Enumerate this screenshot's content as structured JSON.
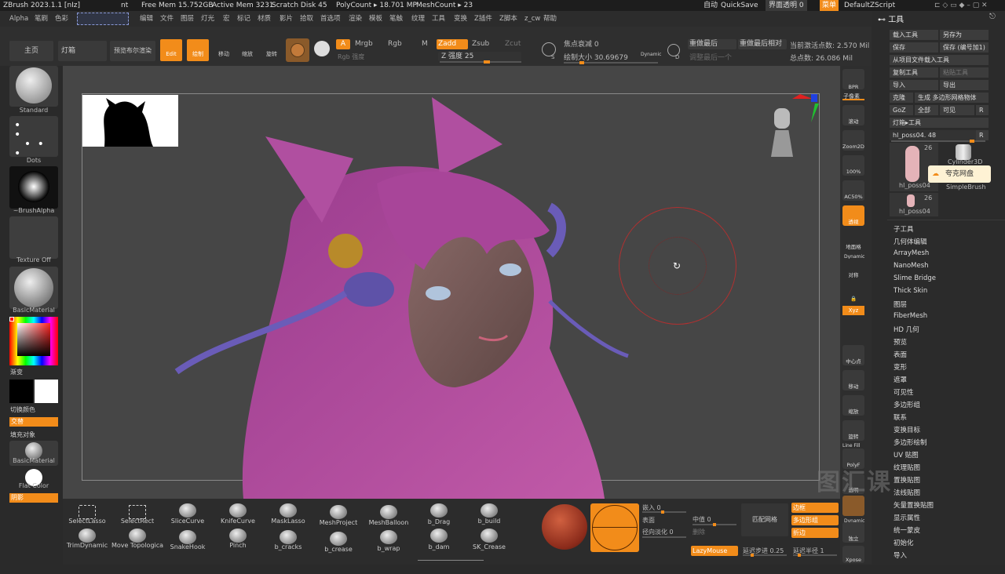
{
  "titlebar": {
    "app": "ZBrush 2023.1.1 [nIz]",
    "frag": "nt",
    "free_mem": "Free Mem 15.752GB",
    "active_mem": "Active Mem 3231",
    "scratch": "Scratch Disk 45",
    "polycount": "PolyCount ▸ 18.701 MP",
    "meshcount": "MeshCount ▸ 23",
    "auto": "自动",
    "quicksave": "QuickSave",
    "transparency": "界面透明 0",
    "menu": "菜单",
    "script": "DefaultZScript"
  },
  "menubar": [
    "Alpha",
    "笔刷",
    "色彩",
    "编辑",
    "文件",
    "图层",
    "灯光",
    "宏",
    "标记",
    "材质",
    "影片",
    "拾取",
    "首选项",
    "渲染",
    "模板",
    "笔触",
    "纹理",
    "工具",
    "变换",
    "Z插件",
    "Z脚本",
    "z_cw",
    "帮助"
  ],
  "topshelf": {
    "home": "主页",
    "lightbox": "灯箱",
    "bpr": "预览布尔渲染",
    "edit": "Edit",
    "draw": "绘制",
    "move": "移动",
    "scale": "缩放",
    "rotate": "旋转",
    "a": "A",
    "mrgb": "Mrgb",
    "rgb": "Rgb",
    "m": "M",
    "zadd": "Zadd",
    "zsub": "Zsub",
    "zcut": "Zcut",
    "rgb_intensity": "Rgb 强度",
    "z_intensity": "Z 强度 25",
    "focal": "焦点衰减 0",
    "draw_size": "绘制大小 30.69679",
    "dynamic": "Dynamic",
    "s": "S",
    "d": "D",
    "redo_last": "重做最后",
    "redo_last_rel": "重做最后相对",
    "adjust_last": "调整最后一个",
    "active_points": "当前激活点数: 2.570 Mil",
    "total_points": "总点数: 26.086 Mil"
  },
  "leftshelf": {
    "standard": "Standard",
    "dots": "Dots",
    "brushalpha": "~BrushAlpha",
    "texture_off": "Texture Off",
    "basic_material": "BasicMaterial",
    "gradient": "渐变",
    "switch_color": "切换颜色",
    "alternate": "交替",
    "fill_object": "填充对象",
    "basic_material2": "BasicMaterial",
    "flat_color": "Flat Color",
    "shadow": "阴影"
  },
  "rightshelf": [
    "BPR",
    "子像素",
    "滚动",
    "Zoom2D",
    "100%",
    "AC50%",
    "透视",
    "地面格",
    "Dynamic",
    "对称",
    "",
    "Xyz",
    "",
    "中心点",
    "移动",
    "缩放",
    "旋转",
    "Line Fill",
    "PolyF",
    "透明",
    "Dynamic",
    "独立",
    "Xpose"
  ],
  "toolpanel": {
    "title": "工具",
    "load_tool": "载入工具",
    "save_as": "另存为",
    "save": "保存",
    "save_inc": "保存 (编号加1)",
    "load_from_project": "从项目文件载入工具",
    "copy_tool": "复制工具",
    "paste_tool": "粘贴工具",
    "import": "导入",
    "export": "导出",
    "clone": "克隆",
    "make_polymesh": "生成 多边形网格物体",
    "goz": "GoZ",
    "all": "全部",
    "visible": "可见",
    "r": "R",
    "lightbox_tools": "灯箱▸工具",
    "current_tool": "hl_poss04. 48",
    "thumb1_count": "26",
    "thumb1_label": "hl_poss04",
    "thumb2_label": "Cylinder3D",
    "thumb3_label": "SimpleBrush",
    "thumb4_count": "26",
    "thumb4_label": "hl_poss04",
    "popup": "夸克网盘",
    "list": [
      "子工具",
      "几何体编辑",
      "ArrayMesh",
      "NanoMesh",
      "Slime Bridge",
      "Thick Skin",
      "图层",
      "FiberMesh",
      "HD 几何",
      "预览",
      "表面",
      "变形",
      "遮罩",
      "可见性",
      "多边形组",
      "联系",
      "变换目标",
      "多边形绘制",
      "UV 贴图",
      "纹理贴图",
      "置换贴图",
      "法线贴图",
      "矢量置换贴图",
      "显示属性",
      "统一蒙皮",
      "初始化",
      "导入"
    ]
  },
  "bottombar": {
    "brushes": [
      "SelectLasso",
      "SelectRect",
      "SliceCurve",
      "KnifeCurve",
      "MaskLasso",
      "MeshProject",
      "MeshBalloon",
      "b_Drag",
      "b_build",
      "TrimDynamic",
      "Move Topologica",
      "SnakeHook",
      "Pinch",
      "b_cracks",
      "b_crease",
      "b_wrap",
      "b_dam",
      "SK_Crease"
    ],
    "embed": "嵌入 0",
    "surface": "表面",
    "radial_fade": "径向淡化 0",
    "median": "中值 0",
    "delete": "删除",
    "match_mesh": "匹配网格",
    "border": "边框",
    "polygroup": "多边形组",
    "crease": "折边",
    "lazymouse": "LazyMouse",
    "lazy_step": "延迟步进 0.25",
    "lazy_radius": "延迟半径 1"
  },
  "watermark": "图汇课"
}
